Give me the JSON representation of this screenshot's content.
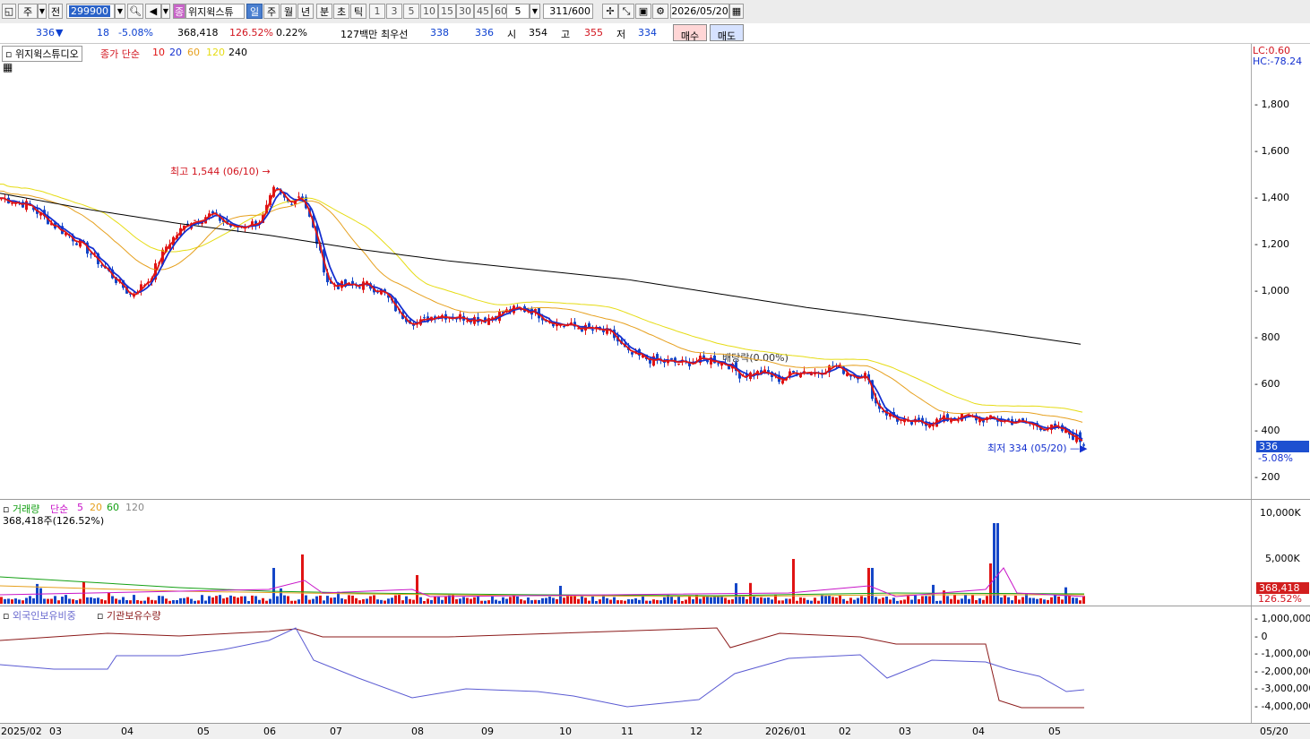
{
  "toolbar": {
    "period_type": "주",
    "prev_label": "전",
    "code": "299900",
    "stock_name": "위지윅스튜",
    "stock_badge": "종",
    "periods": [
      "일",
      "주",
      "월",
      "년",
      "분",
      "초",
      "틱"
    ],
    "active_period": "일",
    "numbers": [
      "1",
      "3",
      "5",
      "10",
      "15",
      "30",
      "45",
      "60"
    ],
    "count_sel": "5",
    "page_value": "311",
    "page_total": "/600",
    "date": "2026/05/20"
  },
  "quote": {
    "price": "336",
    "arrow": "▼",
    "change": "18",
    "change_pct": "-5.08%",
    "volume": "368,418",
    "volume_pct": "126.52%",
    "turnover": "0.22%",
    "amount": "127백만",
    "best_label": "최우선",
    "best_ask": "338",
    "best_bid": "336",
    "open_label": "시",
    "open": "354",
    "high_label": "고",
    "high": "355",
    "low_label": "저",
    "low": "334",
    "buy": "매수",
    "sell": "매도"
  },
  "price_panel": {
    "name_tag": "위지윅스튜디오",
    "ma_label": "종가 단순",
    "ma_periods": [
      "10",
      "20",
      "60",
      "120",
      "240"
    ],
    "ma_colors": [
      "#e01414",
      "#1430d0",
      "#e6a01e",
      "#e6dc14",
      "#000000"
    ],
    "lc": "LC:0.60",
    "hc": "HC:-78.24",
    "yticks": [
      "1,800",
      "1,600",
      "1,400",
      "1,200",
      "1,000",
      "800",
      "600",
      "400",
      "200"
    ],
    "yvalues": [
      1800,
      1600,
      1400,
      1200,
      1000,
      800,
      600,
      400,
      200
    ],
    "current": "336",
    "current_pct": "-5.08%",
    "high_note": "최고 1,544 (06/10)",
    "low_note": "최저 334 (05/20)",
    "dividend_note": "배당락(0.00%)"
  },
  "volume_panel": {
    "title": "거래량",
    "ma_label": "단순",
    "ma_periods": [
      "5",
      "20",
      "60",
      "120"
    ],
    "ma_colors": [
      "#c814c8",
      "#e6a01e",
      "#14a014",
      "#888888"
    ],
    "value_text": "368,418주(126.52%)",
    "yticks": [
      "10,000K",
      "5,000K"
    ],
    "current": "368,418",
    "current_pct": "126.52%"
  },
  "holding_panel": {
    "series1": "외국인보유비중",
    "series2": "기관보유수량",
    "yticks": [
      "1,000,000",
      "0",
      "-1,000,000",
      "-2,000,000",
      "-3,000,000",
      "-4,000,000"
    ]
  },
  "months": [
    "2025/02",
    "03",
    "04",
    "05",
    "06",
    "07",
    "08",
    "09",
    "10",
    "11",
    "12",
    "2026/01",
    "02",
    "03",
    "04",
    "05"
  ],
  "axis_date": "05/20",
  "chart_data": {
    "type": "candlestick",
    "x_range": [
      "2025/02",
      "2026/05/20"
    ],
    "ylim": [
      200,
      1800
    ],
    "high": {
      "value": 1544,
      "date": "06/10"
    },
    "low": {
      "value": 334,
      "date": "05/20"
    },
    "anchors": [
      [
        0,
        1400
      ],
      [
        30,
        1370
      ],
      [
        60,
        1280
      ],
      [
        90,
        1200
      ],
      [
        120,
        1080
      ],
      [
        145,
        980
      ],
      [
        165,
        1050
      ],
      [
        185,
        1200
      ],
      [
        210,
        1300
      ],
      [
        235,
        1330
      ],
      [
        260,
        1270
      ],
      [
        290,
        1300
      ],
      [
        305,
        1440
      ],
      [
        320,
        1380
      ],
      [
        335,
        1420
      ],
      [
        350,
        1240
      ],
      [
        365,
        1030
      ],
      [
        385,
        1020
      ],
      [
        405,
        1030
      ],
      [
        425,
        1000
      ],
      [
        445,
        900
      ],
      [
        465,
        860
      ],
      [
        485,
        900
      ],
      [
        510,
        890
      ],
      [
        540,
        880
      ],
      [
        570,
        920
      ],
      [
        590,
        920
      ],
      [
        620,
        860
      ],
      [
        650,
        840
      ],
      [
        680,
        820
      ],
      [
        700,
        730
      ],
      [
        730,
        700
      ],
      [
        760,
        690
      ],
      [
        790,
        710
      ],
      [
        810,
        690
      ],
      [
        825,
        640
      ],
      [
        850,
        650
      ],
      [
        870,
        620
      ],
      [
        890,
        660
      ],
      [
        910,
        650
      ],
      [
        930,
        680
      ],
      [
        950,
        640
      ],
      [
        965,
        640
      ],
      [
        975,
        520
      ],
      [
        990,
        470
      ],
      [
        1010,
        430
      ],
      [
        1040,
        440
      ],
      [
        1070,
        460
      ],
      [
        1100,
        450
      ],
      [
        1130,
        440
      ],
      [
        1160,
        420
      ],
      [
        1185,
        400
      ],
      [
        1200,
        370
      ],
      [
        1210,
        340
      ]
    ],
    "ma240": [
      [
        0,
        1420
      ],
      [
        100,
        1350
      ],
      [
        200,
        1290
      ],
      [
        300,
        1240
      ],
      [
        400,
        1180
      ],
      [
        500,
        1130
      ],
      [
        600,
        1090
      ],
      [
        700,
        1050
      ],
      [
        800,
        990
      ],
      [
        900,
        930
      ],
      [
        1000,
        880
      ],
      [
        1100,
        830
      ],
      [
        1210,
        770
      ]
    ]
  }
}
